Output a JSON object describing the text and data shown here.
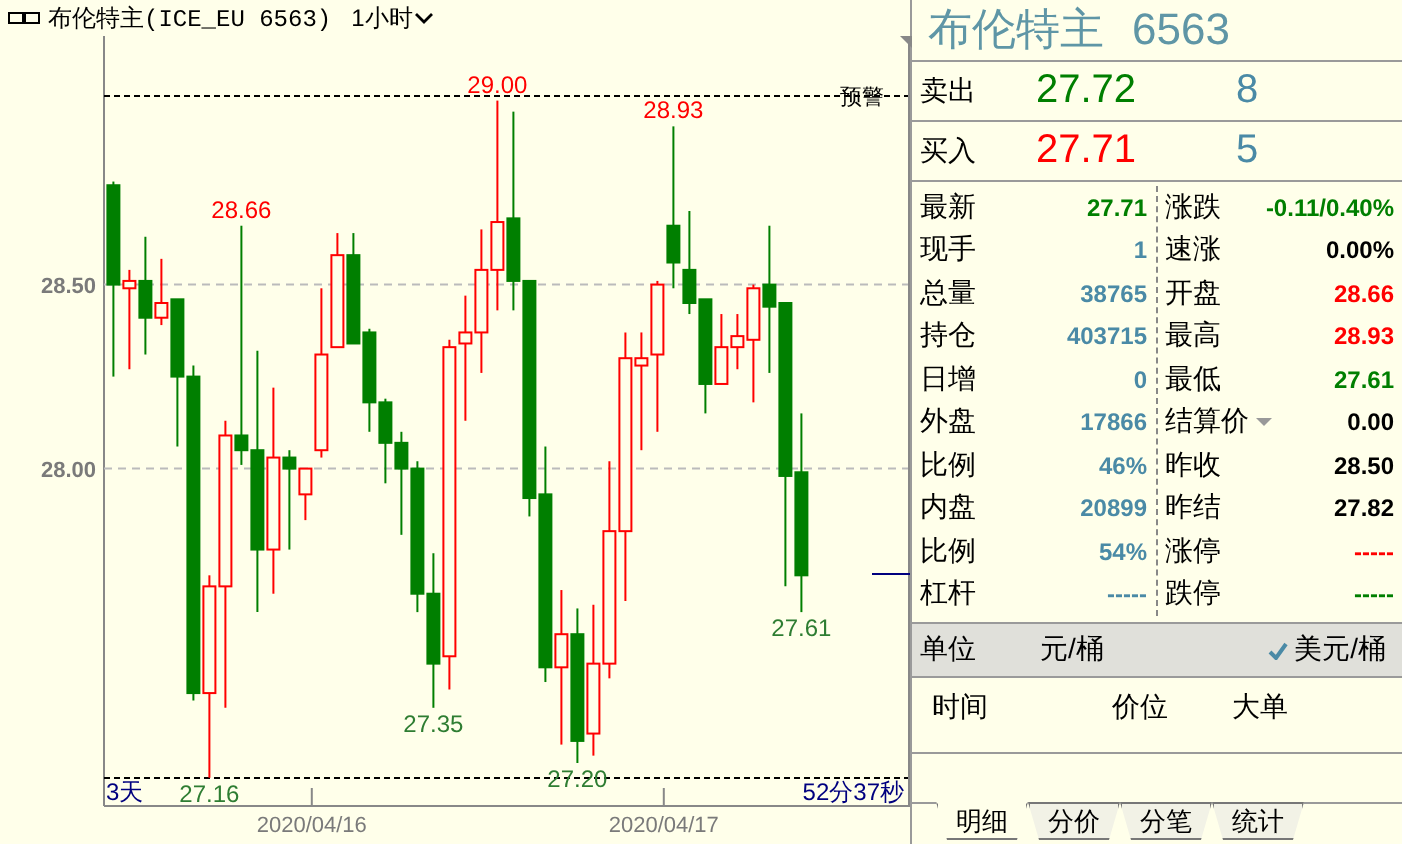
{
  "header": {
    "title": "布伦特主(ICE_EU 6563)",
    "period": "1小时"
  },
  "chart": {
    "alert_label": "预警",
    "timer_left": "3天",
    "timer_right": "52分37秒",
    "y_axis_labels": [
      "28.50",
      "28.00"
    ],
    "x_axis_labels": [
      "2020/04/16",
      "2020/04/17"
    ],
    "price_labels": [
      {
        "text": "28.66",
        "kind": "high"
      },
      {
        "text": "29.00",
        "kind": "high"
      },
      {
        "text": "28.93",
        "kind": "high"
      },
      {
        "text": "27.16",
        "kind": "low"
      },
      {
        "text": "27.35",
        "kind": "low"
      },
      {
        "text": "27.20",
        "kind": "low"
      },
      {
        "text": "27.61",
        "kind": "low"
      }
    ]
  },
  "quote": {
    "title": "布伦特主",
    "code": "6563",
    "book": [
      {
        "label": "卖出",
        "price": "27.72",
        "size": "8",
        "color": "#007f00"
      },
      {
        "label": "买入",
        "price": "27.71",
        "size": "5",
        "color": "#ff0000"
      }
    ],
    "left": [
      {
        "label": "最新",
        "value": "27.71",
        "color": "#007f00"
      },
      {
        "label": "现手",
        "value": "1",
        "color": "#4a8aa6"
      },
      {
        "label": "总量",
        "value": "38765",
        "color": "#4a8aa6"
      },
      {
        "label": "持仓",
        "value": "403715",
        "color": "#4a8aa6"
      },
      {
        "label": "日增",
        "value": "0",
        "color": "#4a8aa6"
      },
      {
        "label": "外盘",
        "value": "17866",
        "color": "#4a8aa6"
      },
      {
        "label": "比例",
        "value": "46%",
        "color": "#4a8aa6"
      },
      {
        "label": "内盘",
        "value": "20899",
        "color": "#4a8aa6"
      },
      {
        "label": "比例",
        "value": "54%",
        "color": "#4a8aa6"
      },
      {
        "label": "杠杆",
        "value": "-----",
        "color": "#4a8aa6"
      }
    ],
    "right": [
      {
        "label": "涨跌",
        "value": "-0.11/0.40%",
        "color": "#007f00",
        "kind": "plain"
      },
      {
        "label": "速涨",
        "value": "0.00%",
        "color": "#000000",
        "kind": "plain"
      },
      {
        "label": "开盘",
        "value": "28.66",
        "color": "#ff0000",
        "kind": "plain"
      },
      {
        "label": "最高",
        "value": "28.93",
        "color": "#ff0000",
        "kind": "plain"
      },
      {
        "label": "最低",
        "value": "27.61",
        "color": "#007f00",
        "kind": "plain"
      },
      {
        "label": "结算价",
        "value": "0.00",
        "color": "#000000",
        "kind": "dropdown"
      },
      {
        "label": "昨收",
        "value": "28.50",
        "color": "#000000",
        "kind": "plain"
      },
      {
        "label": "昨结",
        "value": "27.82",
        "color": "#000000",
        "kind": "plain"
      },
      {
        "label": "涨停",
        "value": "-----",
        "color": "#ff0000",
        "kind": "plain"
      },
      {
        "label": "跌停",
        "value": "-----",
        "color": "#007f00",
        "kind": "plain"
      }
    ],
    "units": {
      "label": "单位",
      "options": [
        {
          "label": "元/桶",
          "selected": false
        },
        {
          "label": "美元/桶",
          "selected": true
        }
      ]
    },
    "trades": {
      "columns": [
        "时间",
        "价位",
        "大单"
      ]
    }
  },
  "tabs": [
    {
      "label": "明细",
      "selected": true
    },
    {
      "label": "分价",
      "selected": false
    },
    {
      "label": "分笔",
      "selected": false
    },
    {
      "label": "统计",
      "selected": false
    }
  ]
}
